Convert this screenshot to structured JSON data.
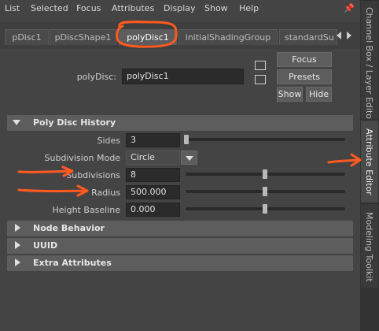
{
  "menubar": {
    "items": [
      "List",
      "Selected",
      "Focus",
      "Attributes",
      "Display",
      "Show",
      "Help"
    ]
  },
  "tabs": [
    "pDisc1",
    "pDiscShape1",
    "polyDisc1",
    "initialShadingGroup",
    "standardSu"
  ],
  "active_tab": "polyDisc1",
  "node": {
    "label": "polyDisc:",
    "name": "polyDisc1"
  },
  "buttons": {
    "focus": "Focus",
    "presets": "Presets",
    "show": "Show",
    "hide": "Hide"
  },
  "sections": {
    "poly_disc_history": "Poly Disc History",
    "node_behavior": "Node Behavior",
    "uuid": "UUID",
    "extra_attributes": "Extra Attributes"
  },
  "attributes": {
    "sides": {
      "label": "Sides",
      "value": "3",
      "slider_fraction": 0.0
    },
    "subdivision_mode": {
      "label": "Subdivision Mode",
      "value": "Circle"
    },
    "subdivisions": {
      "label": "Subdivisions",
      "value": "8",
      "slider_fraction": 0.5
    },
    "radius": {
      "label": "Radius",
      "value": "500.000",
      "slider_fraction": 0.5
    },
    "height_baseline": {
      "label": "Height Baseline",
      "value": "0.000",
      "slider_fraction": 0.5
    }
  },
  "side_tabs": [
    "Channel Box / Layer Editor",
    "Attribute Editor",
    "Modeling Toolkit"
  ],
  "active_side_tab": "Attribute Editor",
  "colors": {
    "panel_bg": "#444444",
    "section_bg": "#5d5d5d",
    "field_bg": "#2b2b2b",
    "annotation": "#ff5a1f"
  }
}
